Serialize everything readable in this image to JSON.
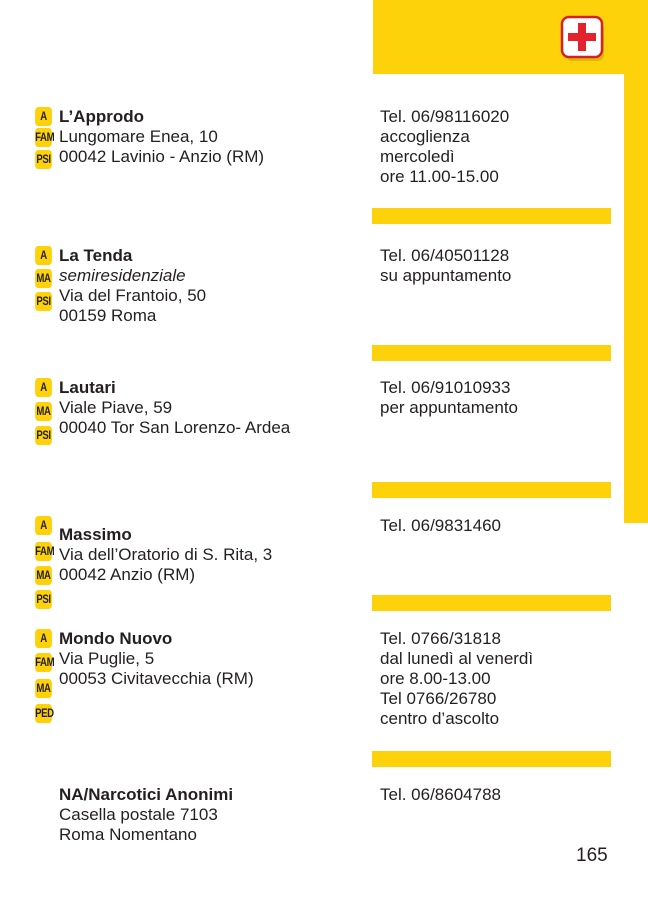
{
  "header": {
    "icon": "first-aid-icon",
    "accent": "#fdd20a"
  },
  "entries": [
    {
      "badges": [
        "A",
        "FAM",
        "PSI"
      ],
      "name": "L’Approdo",
      "lines": [
        "Lungomare Enea, 10",
        "00042 Lavinio - Anzio (RM)"
      ],
      "contact": [
        "Tel. 06/98116020",
        "accoglienza",
        "mercoledì",
        "ore 11.00-15.00"
      ]
    },
    {
      "badges": [
        "A",
        "MA",
        "PSI"
      ],
      "name": "La Tenda",
      "subtitle": "semiresidenziale",
      "lines": [
        "Via del Frantoio, 50",
        "00159 Roma"
      ],
      "contact": [
        "Tel. 06/40501128",
        "su appuntamento"
      ]
    },
    {
      "badges": [
        "A",
        "MA",
        "PSI"
      ],
      "name": "Lautari",
      "lines": [
        "Viale Piave, 59",
        "00040 Tor San Lorenzo- Ardea"
      ],
      "contact": [
        "Tel. 06/91010933",
        "per appuntamento"
      ]
    },
    {
      "badges": [
        "A",
        "FAM",
        "MA",
        "PSI"
      ],
      "name": "Massimo",
      "lines": [
        "Via dell’Oratorio di S. Rita, 3",
        "00042 Anzio (RM)"
      ],
      "contact": [
        "Tel. 06/9831460"
      ]
    },
    {
      "badges": [
        "A",
        "FAM",
        "MA",
        "PED"
      ],
      "name": "Mondo Nuovo",
      "lines": [
        "Via Puglie, 5",
        "00053 Civitavecchia (RM)"
      ],
      "contact": [
        "Tel. 0766/31818",
        "dal lunedì al venerdì",
        "ore 8.00-13.00",
        "Tel 0766/26780",
        "centro d’ascolto"
      ]
    },
    {
      "badges": [],
      "name": "NA/Narcotici Anonimi",
      "lines": [
        "Casella postale 7103",
        "Roma Nomentano"
      ],
      "contact": [
        "Tel. 06/8604788"
      ]
    }
  ],
  "page_number": "165"
}
